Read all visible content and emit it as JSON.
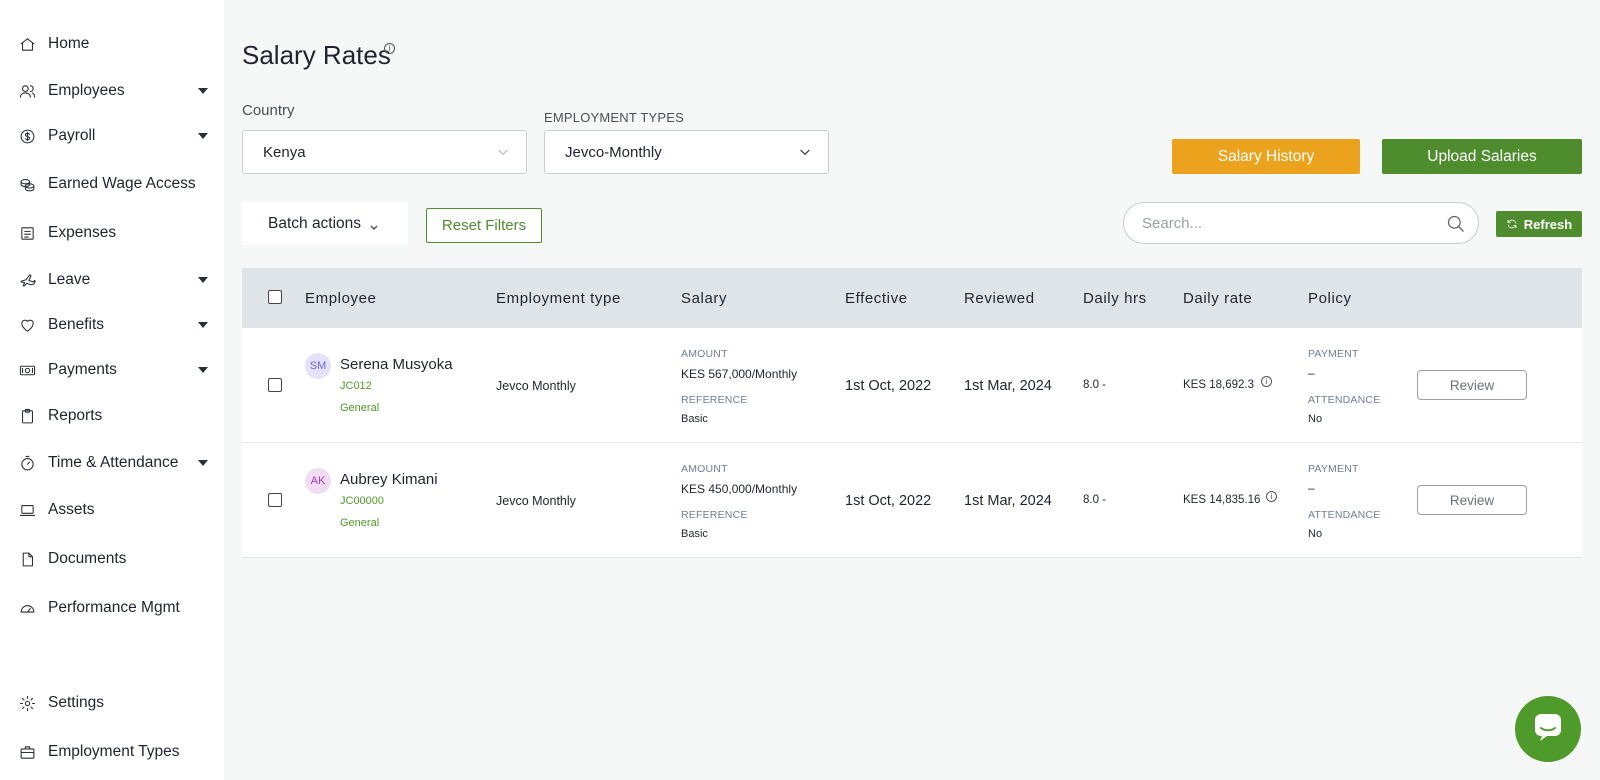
{
  "sidebar": {
    "items": [
      {
        "label": "Home",
        "icon": "home-icon",
        "has_caret": false
      },
      {
        "label": "Employees",
        "icon": "users-icon",
        "has_caret": true
      },
      {
        "label": "Payroll",
        "icon": "dollar-icon",
        "has_caret": true
      },
      {
        "label": "Earned Wage Access",
        "icon": "coins-icon",
        "has_caret": false
      },
      {
        "label": "Expenses",
        "icon": "receipt-icon",
        "has_caret": false
      },
      {
        "label": "Leave",
        "icon": "plane-icon",
        "has_caret": true
      },
      {
        "label": "Benefits",
        "icon": "heart-icon",
        "has_caret": true
      },
      {
        "label": "Payments",
        "icon": "money-icon",
        "has_caret": true
      },
      {
        "label": "Reports",
        "icon": "clipboard-icon",
        "has_caret": false
      },
      {
        "label": "Time & Attendance",
        "icon": "stopwatch-icon",
        "has_caret": true
      },
      {
        "label": "Assets",
        "icon": "laptop-icon",
        "has_caret": false
      },
      {
        "label": "Documents",
        "icon": "document-icon",
        "has_caret": false
      },
      {
        "label": "Performance Mgmt",
        "icon": "gauge-icon",
        "has_caret": false
      },
      {
        "label": "Settings",
        "icon": "gear-icon",
        "has_caret": false
      },
      {
        "label": "Employment Types",
        "icon": "briefcase-icon",
        "has_caret": false
      }
    ]
  },
  "header": {
    "title": "Salary Rates",
    "title_info": "i"
  },
  "filters": {
    "country_label": "Country",
    "country_value": "Kenya",
    "employment_label": "EMPLOYMENT TYPES",
    "employment_value": "Jevco-Monthly"
  },
  "actions": {
    "salary_history": "Salary History",
    "upload_salaries": "Upload Salaries",
    "batch_actions": "Batch actions",
    "reset_filters": "Reset Filters",
    "search_placeholder": "Search...",
    "refresh": "Refresh"
  },
  "table": {
    "columns": [
      "Employee",
      "Employment type",
      "Salary",
      "Effective",
      "Reviewed",
      "Daily hrs",
      "Daily rate",
      "Policy"
    ],
    "rows": [
      {
        "initials": "SM",
        "name": "Serena Musyoka",
        "code": "JC012",
        "group": "General",
        "employment_type": "Jevco Monthly",
        "amount_label": "AMOUNT",
        "amount": "KES 567,000/Monthly",
        "reference_label": "REFERENCE",
        "reference": "Basic",
        "effective": "1st Oct, 2022",
        "reviewed": "1st Mar, 2024",
        "daily_hrs": "8.0 -",
        "daily_rate": "KES 18,692.3",
        "payment_label": "PAYMENT",
        "payment": "–",
        "attendance_label": "ATTENDANCE",
        "attendance": "No",
        "review": "Review"
      },
      {
        "initials": "AK",
        "name": "Aubrey Kimani",
        "code": "JC00000",
        "group": "General",
        "employment_type": "Jevco Monthly",
        "amount_label": "AMOUNT",
        "amount": "KES 450,000/Monthly",
        "reference_label": "REFERENCE",
        "reference": "Basic",
        "effective": "1st Oct, 2022",
        "reviewed": "1st Mar, 2024",
        "daily_hrs": "8.0 -",
        "daily_rate": "KES 14,835.16",
        "payment_label": "PAYMENT",
        "payment": "–",
        "attendance_label": "ATTENDANCE",
        "attendance": "No",
        "review": "Review"
      }
    ]
  },
  "colors": {
    "accent_green": "#4e8c2e",
    "accent_orange": "#eba21d",
    "code_green": "#4e9a2a",
    "avatar1_bg": "#e4e2fb",
    "avatar1_fg": "#6f63d9",
    "avatar2_bg": "#f1dcf4",
    "avatar2_fg": "#a13bb8"
  },
  "chat": {
    "icon": "chat-icon"
  }
}
